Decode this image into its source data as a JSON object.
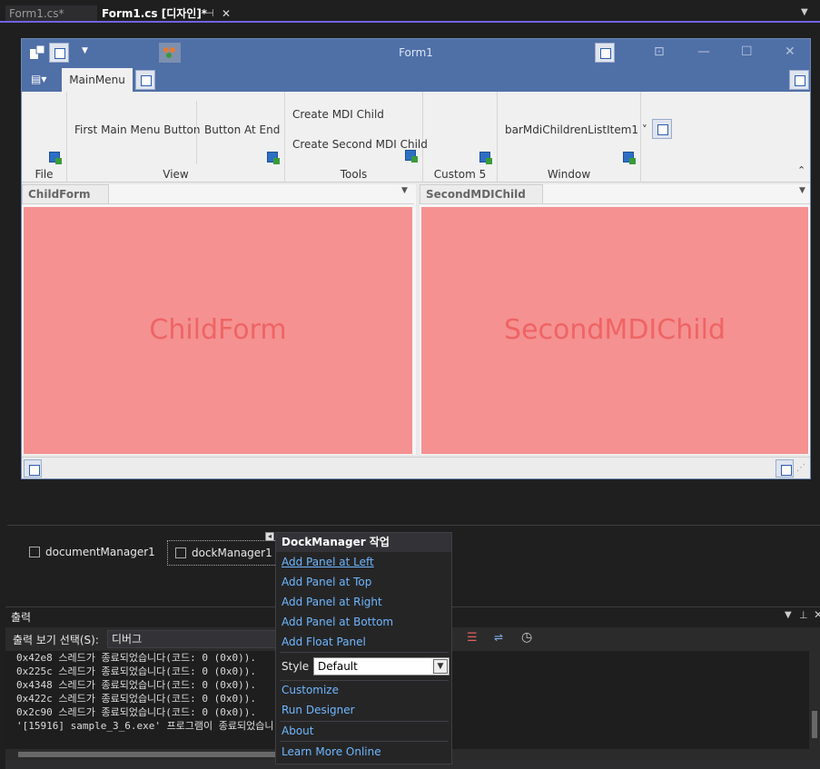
{
  "tabs": [
    {
      "label": "Form1.cs*"
    },
    {
      "label": "Form1.cs [디자인]*",
      "pin": "⊣",
      "close": "✕"
    }
  ],
  "form": {
    "title": "Form1",
    "menu_tab": "MainMenu",
    "groups": [
      {
        "label": "File"
      },
      {
        "label": "View",
        "buttons": [
          "First Main Menu Button",
          "Button At End"
        ]
      },
      {
        "label": "Tools",
        "buttons": [
          "Create MDI Child",
          "Create Second MDI Child"
        ]
      },
      {
        "label": "Custom 5"
      },
      {
        "label": "Window",
        "buttons": [
          "barMdiChildrenListItem1 ˅"
        ]
      }
    ],
    "children": [
      {
        "tab": "ChildForm",
        "content": "ChildForm"
      },
      {
        "tab": "SecondMDIChild",
        "content": "SecondMDIChild"
      }
    ]
  },
  "tray": {
    "items": [
      "documentManager1",
      "dockManager1"
    ]
  },
  "smart_tag": {
    "header": "DockManager 작업",
    "actions": [
      "Add Panel at Left",
      "Add Panel at Top",
      "Add Panel at Right",
      "Add Panel at Bottom",
      "Add Float Panel"
    ],
    "style_label": "Style",
    "style_value": "Default",
    "links": [
      "Customize",
      "Run Designer",
      "About",
      "Learn More Online"
    ]
  },
  "output": {
    "title": "출력",
    "select_label": "출력 보기 선택(S):",
    "select_value": "디버그",
    "lines": [
      "0x42e8 스레드가 종료되었습니다(코드: 0 (0x0)).",
      "0x225c 스레드가 종료되었습니다(코드: 0 (0x0)).",
      "0x4348 스레드가 종료되었습니다(코드: 0 (0x0)).",
      "0x422c 스레드가 종료되었습니다(코드: 0 (0x0)).",
      "0x2c90 스레드가 종료되었습니다(코드: 0 (0x0)).",
      "'[15916] sample_3_6.exe' 프로그램이 종료되었습니"
    ]
  },
  "colors": {
    "accent": "#7160e8",
    "titlebar": "#4f6fa7",
    "child_bg": "#f59191",
    "link": "#6fb7ff"
  }
}
